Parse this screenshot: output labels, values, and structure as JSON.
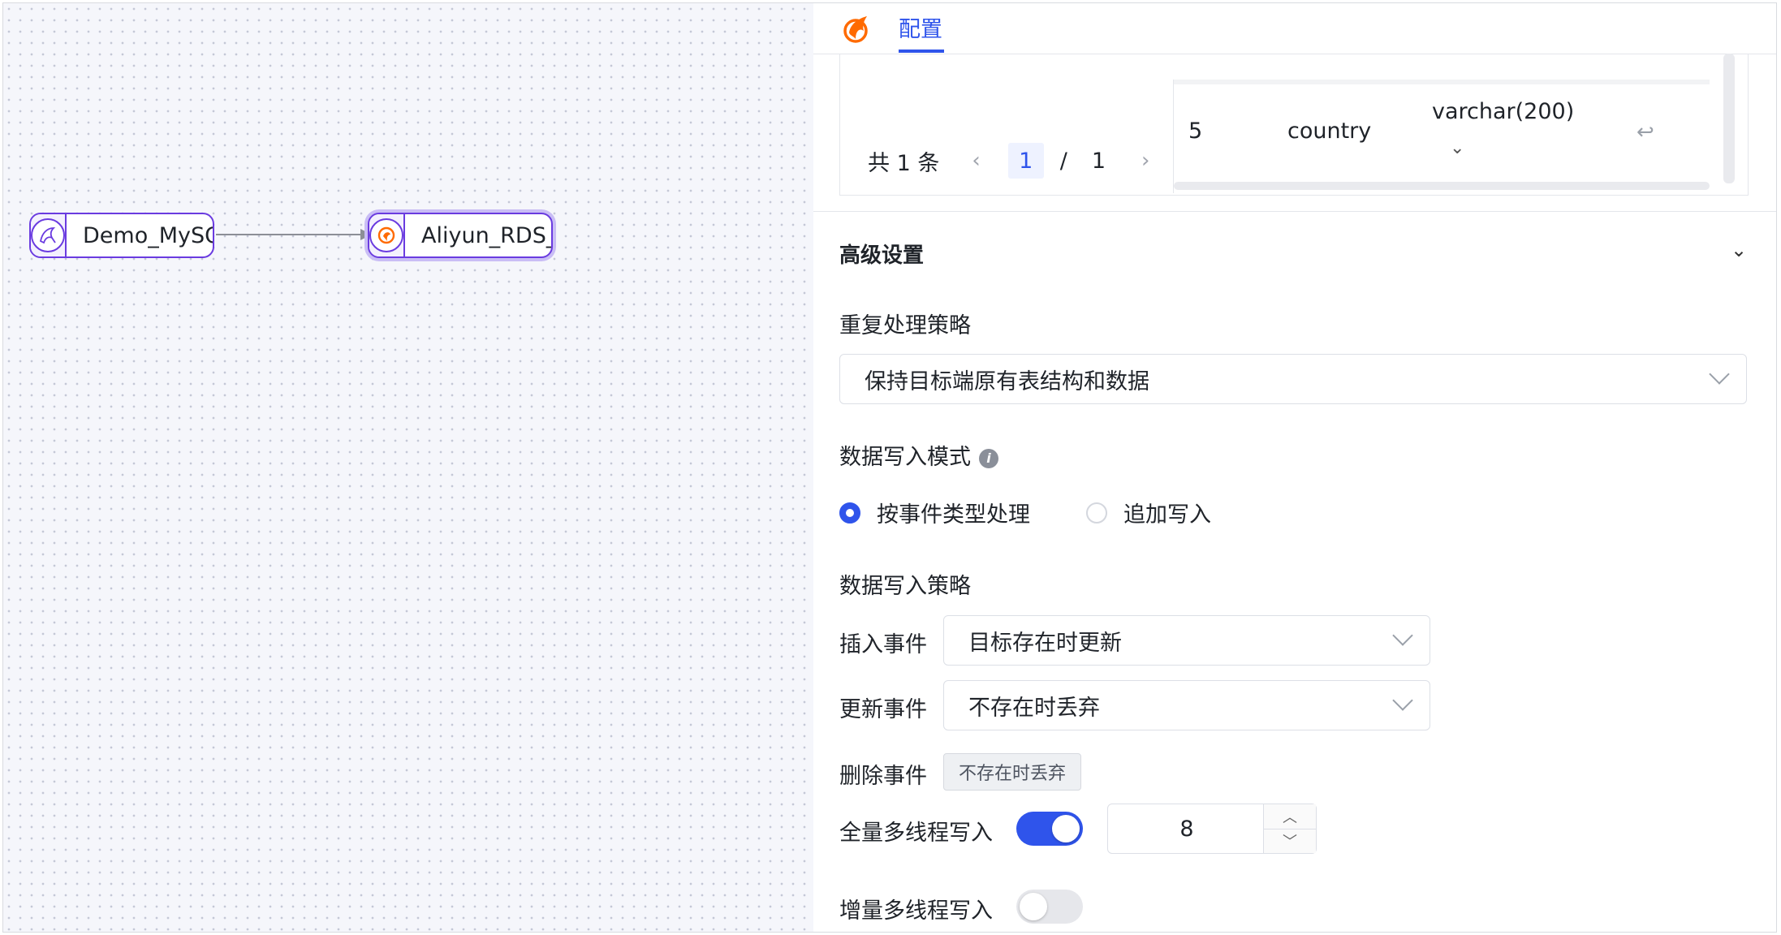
{
  "canvas": {
    "source_node": {
      "label": "Demo_MySQL",
      "icon": "mysql-dolphin-icon"
    },
    "target_node": {
      "label": "Aliyun_RDS_M...",
      "icon": "aliyun-rds-icon"
    }
  },
  "panel": {
    "tab_label": "配置",
    "pagination": {
      "total_text": "共 1 条",
      "current_page": "1",
      "separator": "/",
      "total_pages": "1"
    },
    "field_row": {
      "index": "5",
      "name": "country",
      "type": "varchar(200)"
    },
    "advanced": {
      "title": "高级设置",
      "dup_strategy_label": "重复处理策略",
      "dup_strategy_value": "保持目标端原有表结构和数据",
      "write_mode_label": "数据写入模式",
      "write_mode_options": [
        "按事件类型处理",
        "追加写入"
      ],
      "write_mode_selected": 0,
      "write_strategy_label": "数据写入策略",
      "insert_label": "插入事件",
      "insert_value": "目标存在时更新",
      "update_label": "更新事件",
      "update_value": "不存在时丢弃",
      "delete_label": "删除事件",
      "delete_value": "不存在时丢弃",
      "full_mt_label": "全量多线程写入",
      "full_mt_enabled": true,
      "full_mt_threads": "8",
      "inc_mt_label": "增量多线程写入",
      "inc_mt_enabled": false
    }
  },
  "colors": {
    "primary": "#2f54eb",
    "node_border": "#6a3be0",
    "logo_orange": "#ff6a00"
  }
}
